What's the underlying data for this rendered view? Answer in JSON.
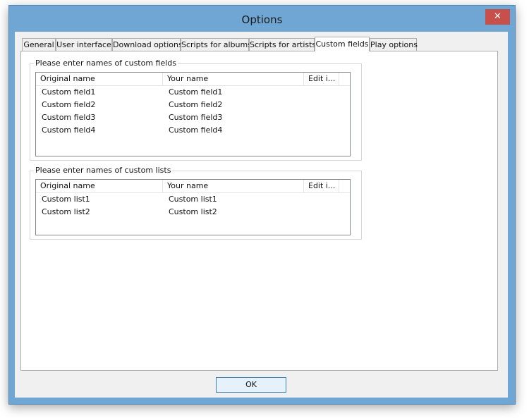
{
  "window": {
    "title": "Options",
    "close_symbol": "✕"
  },
  "tabs": [
    {
      "label": "General"
    },
    {
      "label": "User interface"
    },
    {
      "label": "Download options"
    },
    {
      "label": "Scripts for albums"
    },
    {
      "label": "Scripts for artists"
    },
    {
      "label": "Custom fields"
    },
    {
      "label": "Play options"
    }
  ],
  "active_tab": "Custom fields",
  "fields_group": {
    "label": "Please enter names of custom fields",
    "columns": [
      "Original name",
      "Your name",
      "Edit i..."
    ],
    "rows": [
      [
        "Custom field1",
        "Custom field1"
      ],
      [
        "Custom field2",
        "Custom field2"
      ],
      [
        "Custom field3",
        "Custom field3"
      ],
      [
        "Custom field4",
        "Custom field4"
      ]
    ]
  },
  "lists_group": {
    "label": "Please enter names of custom lists",
    "columns": [
      "Original name",
      "Your name",
      "Edit i..."
    ],
    "rows": [
      [
        "Custom list1",
        "Custom list1"
      ],
      [
        "Custom list2",
        "Custom list2"
      ]
    ]
  },
  "buttons": {
    "ok": "OK"
  }
}
